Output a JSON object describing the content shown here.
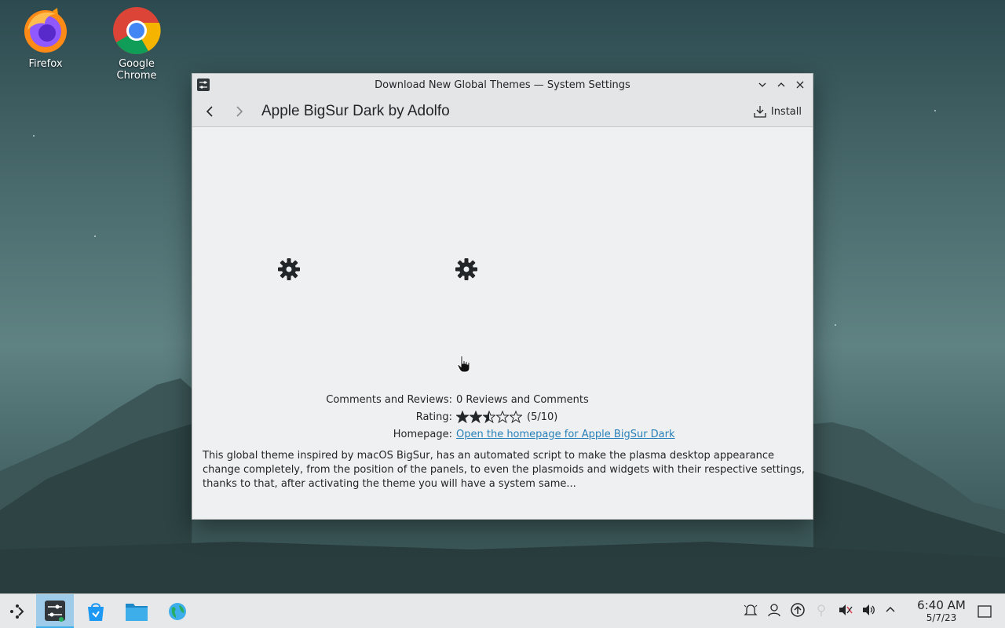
{
  "desktop": {
    "icons": [
      {
        "label": "Firefox",
        "icon": "firefox-icon"
      },
      {
        "label": "Google Chrome",
        "icon": "chrome-icon"
      }
    ]
  },
  "window": {
    "title": "Download New Global Themes — System Settings",
    "toolbar": {
      "page_title": "Apple BigSur Dark by Adolfo",
      "install_label": "Install"
    },
    "details": {
      "comments_label": "Comments and Reviews:",
      "comments_value": "0 Reviews and Comments",
      "rating_label": "Rating:",
      "rating_value": "(5/10)",
      "rating_stars": 2.5,
      "rating_max": 5,
      "homepage_label": "Homepage:",
      "homepage_link": "Open the homepage for Apple BigSur Dark"
    },
    "description": "This global theme inspired by macOS BigSur, has an automated script to make the plasma desktop appearance change completely, from the position of the panels, to even the plasmoids and widgets with their respective settings, thanks to that, after activating the theme you will have a system same..."
  },
  "taskbar": {
    "clock_time": "6:40 AM",
    "clock_date": "5/7/23",
    "tasks": [
      "app-launcher-icon",
      "system-settings-icon",
      "discover-icon",
      "file-manager-icon",
      "browser-globe-icon"
    ],
    "tray": [
      "notifications-icon",
      "user-icon",
      "updates-icon",
      "network-icon",
      "audio-muted-icon",
      "volume-icon",
      "expand-tray-icon"
    ]
  },
  "colors": {
    "accent": "#3daee9",
    "link": "#2980b9",
    "window_bg": "#eff0f1"
  }
}
